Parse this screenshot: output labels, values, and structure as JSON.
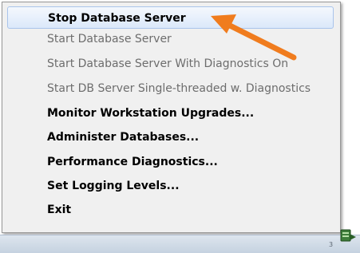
{
  "context_menu": {
    "items": [
      {
        "label": "Stop Database Server",
        "enabled": true,
        "highlighted": true
      },
      {
        "label": "Start Database Server",
        "enabled": false
      },
      {
        "label": "Start Database Server With Diagnostics On",
        "enabled": false
      },
      {
        "label": "Start DB Server Single-threaded w. Diagnostics",
        "enabled": false
      },
      {
        "label": "Monitor Workstation Upgrades...",
        "enabled": true
      },
      {
        "label": "Administer Databases...",
        "enabled": true
      },
      {
        "label": "Performance Diagnostics...",
        "enabled": true
      },
      {
        "label": "Set Logging Levels...",
        "enabled": true
      },
      {
        "label": "Exit",
        "enabled": true
      }
    ]
  },
  "taskbar": {
    "tray_icon": "database-server-tray-icon"
  },
  "annotation": {
    "arrow_icon": "orange-arrow-icon",
    "arrow_color": "#f07c1e"
  },
  "colors": {
    "highlight_border": "#a9c4eb",
    "disabled_text": "#6d6d6d"
  }
}
